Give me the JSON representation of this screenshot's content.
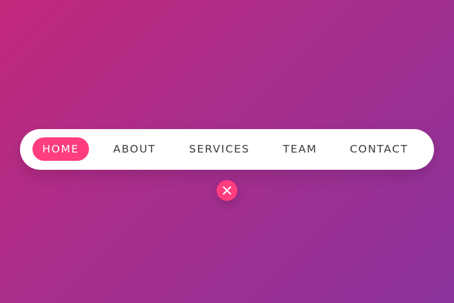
{
  "theme": {
    "accent": "#FF3D7F",
    "background_gradient": [
      "#C3287C",
      "#A72E8C",
      "#8B329C"
    ],
    "nav_background": "#FFFFFF",
    "nav_text": "#3B3B3B"
  },
  "nav": {
    "items": [
      {
        "label": "HOME",
        "active": true
      },
      {
        "label": "ABOUT",
        "active": false
      },
      {
        "label": "SERVICES",
        "active": false
      },
      {
        "label": "TEAM",
        "active": false
      },
      {
        "label": "CONTACT",
        "active": false
      }
    ]
  },
  "close_button": {
    "icon": "close-icon"
  }
}
